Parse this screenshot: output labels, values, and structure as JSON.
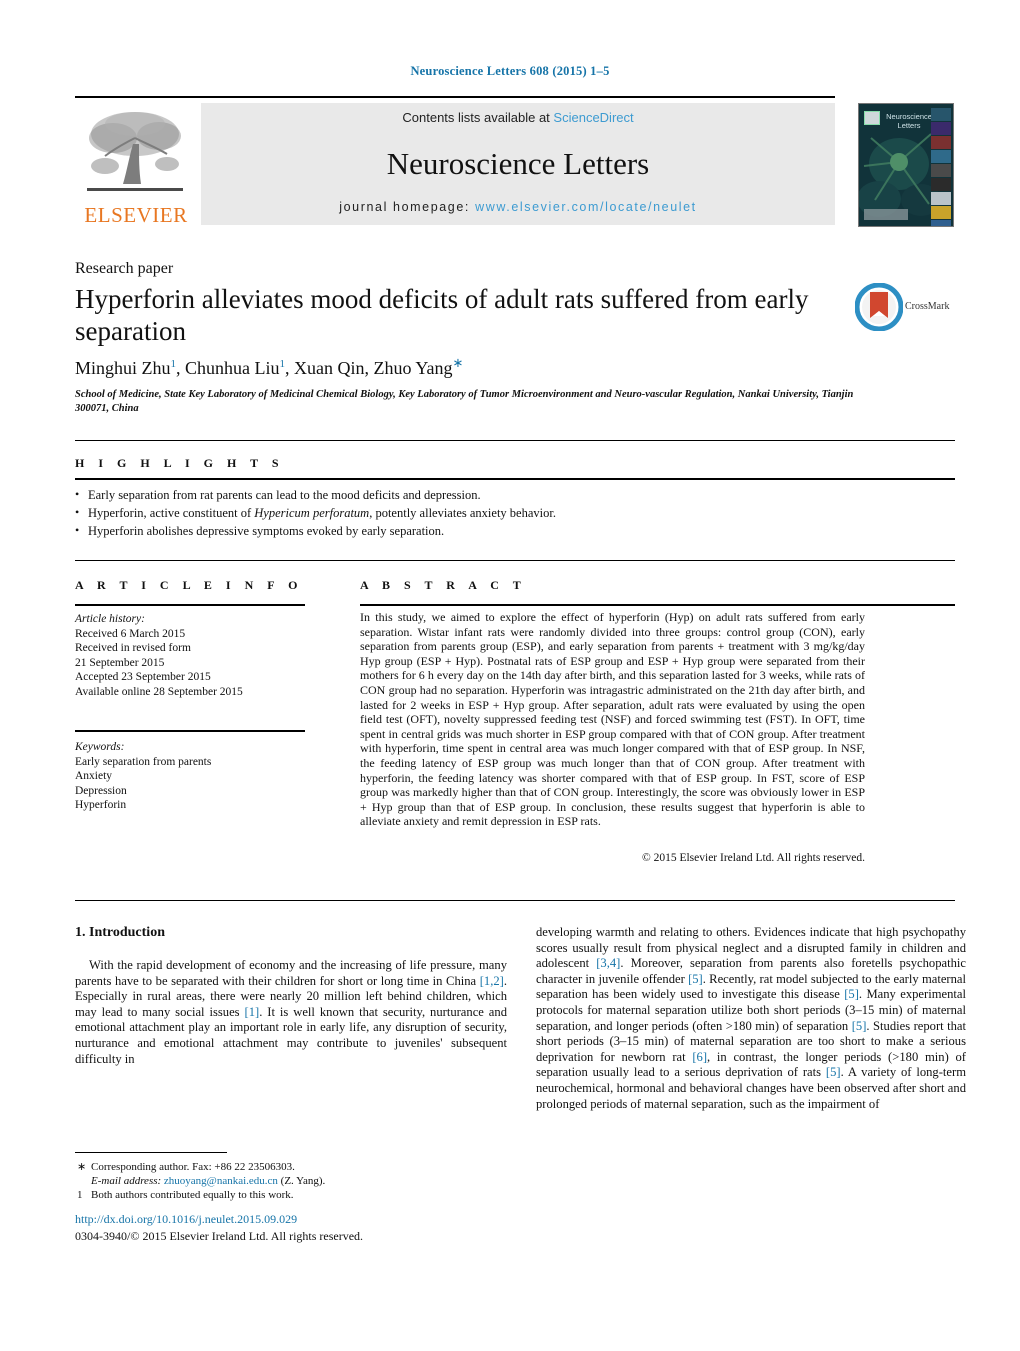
{
  "running_head": "Neuroscience Letters 608 (2015) 1–5",
  "masthead": {
    "contents_prefix": "Contents lists available at",
    "contents_link": "ScienceDirect",
    "journal_title": "Neuroscience Letters",
    "homepage_prefix": "journal homepage:",
    "homepage_link": "www.elsevier.com/locate/neulet",
    "publisher_wordmark": "ELSEVIER",
    "publisher_logo_icon": "elsevier-tree-icon",
    "cover_title": "Neuroscience Letters"
  },
  "article": {
    "type_label": "Research paper",
    "title": "Hyperforin alleviates mood deficits of adult rats suffered from early separation",
    "authors_html": "Minghui Zhu<sup>1</sup>, Chunhua Liu<sup>1</sup>, Xuan Qin, Zhuo Yang<span class=\"star\">∗</span>",
    "affiliation": "School of Medicine, State Key Laboratory of Medicinal Chemical Biology, Key Laboratory of Tumor Microenvironment and Neuro-vascular Regulation, Nankai University, Tianjin 300071, China",
    "crossmark_label": "CrossMark",
    "crossmark_icon": "crossmark-icon"
  },
  "highlights": {
    "label": "H I G H L I G H T S",
    "items_html": [
      "Early separation from rat parents can lead to the mood deficits and depression.",
      "Hyperforin, active constituent of <i>Hypericum perforatum</i>, potently alleviates anxiety behavior.",
      "Hyperforin abolishes depressive symptoms evoked by early separation."
    ]
  },
  "article_info": {
    "label": "A R T I C L E  I N F O",
    "history_heading": "Article history:",
    "history": [
      "Received 6 March 2015",
      "Received in revised form",
      "21 September 2015",
      "Accepted 23 September 2015",
      "Available online 28 September 2015"
    ],
    "keywords_heading": "Keywords:",
    "keywords": [
      "Early separation from parents",
      "Anxiety",
      "Depression",
      "Hyperforin"
    ]
  },
  "abstract": {
    "label": "A B S T R A C T",
    "text": "In this study, we aimed to explore the effect of hyperforin (Hyp) on adult rats suffered from early separation. Wistar infant rats were randomly divided into three groups: control group (CON), early separation from parents group (ESP), and early separation from parents + treatment with 3 mg/kg/day Hyp group (ESP + Hyp). Postnatal rats of ESP group and ESP + Hyp group were separated from their mothers for 6 h every day on the 14th day after birth, and this separation lasted for 3 weeks, while rats of CON group had no separation. Hyperforin was intragastric administrated on the 21th day after birth, and lasted for 2 weeks in ESP + Hyp group. After separation, adult rats were evaluated by using the open field test (OFT), novelty suppressed feeding test (NSF) and forced swimming test (FST). In OFT, time spent in central grids was much shorter in ESP group compared with that of CON group. After treatment with hyperforin, time spent in central area was much longer compared with that of ESP group. In NSF, the feeding latency of ESP group was much longer than that of CON group. After treatment with hyperforin, the feeding latency was shorter compared with that of ESP group. In FST, score of ESP group was markedly higher than that of CON group. Interestingly, the score was obviously lower in ESP + Hyp group than that of ESP group. In conclusion, these results suggest that hyperforin is able to alleviate anxiety and remit depression in ESP rats.",
    "copyright": "© 2015 Elsevier Ireland Ltd. All rights reserved."
  },
  "body": {
    "intro_heading": "1.  Introduction",
    "left_column_html": "With the rapid development of economy and the increasing of life pressure, many parents have to be separated with their children for short or long time in China <span class=\"ref\">[1,2]</span>. Especially in rural areas, there were nearly 20 million left behind children, which may lead to many social issues <span class=\"ref\">[1]</span>. It is well known that security, nurturance and emotional attachment play an important role in early life, any disruption of security, nurturance and emotional attachment may contribute to juveniles' subsequent difficulty in",
    "right_column_html": "developing warmth and relating to others. Evidences indicate that high psychopathy scores usually result from physical neglect and a disrupted family in children and adolescent <span class=\"ref\">[3,4]</span>. Moreover, separation from parents also foretells psychopathic character in juvenile offender <span class=\"ref\">[5]</span>. Recently, rat model subjected to the early maternal separation has been widely used to investigate this disease <span class=\"ref\">[5]</span>. Many experimental protocols for maternal separation utilize both short periods (3–15 min) of maternal separation, and longer periods (often &gt;180 min) of separation <span class=\"ref\">[5]</span>. Studies report that short periods (3–15 min) of maternal separation are too short to make a serious deprivation for newborn rat <span class=\"ref\">[6]</span>, in contrast, the longer periods (&gt;180 min) of separation usually lead to a serious deprivation of rats <span class=\"ref\">[5]</span>. A variety of long-term neurochemical, hormonal and behavioral changes have been observed after short and prolonged periods of maternal separation, such as the impairment of"
  },
  "footnotes": {
    "corresponding_marker": "∗",
    "corresponding_text": "Corresponding author. Fax: +86 22 23506303.",
    "email_label": "E-mail address:",
    "email": "zhuoyang@nankai.edu.cn",
    "email_suffix": "(Z. Yang).",
    "equal_marker": "1",
    "equal_text": "Both authors contributed equally to this work."
  },
  "footer": {
    "doi": "http://dx.doi.org/10.1016/j.neulet.2015.09.029",
    "issn_line": "0304-3940/© 2015 Elsevier Ireland Ltd. All rights reserved."
  },
  "colors": {
    "link_blue": "#1674a8",
    "science_direct_blue": "#3d9bd1",
    "elsevier_orange": "#e87722",
    "band_gray": "#e9e9e9"
  }
}
